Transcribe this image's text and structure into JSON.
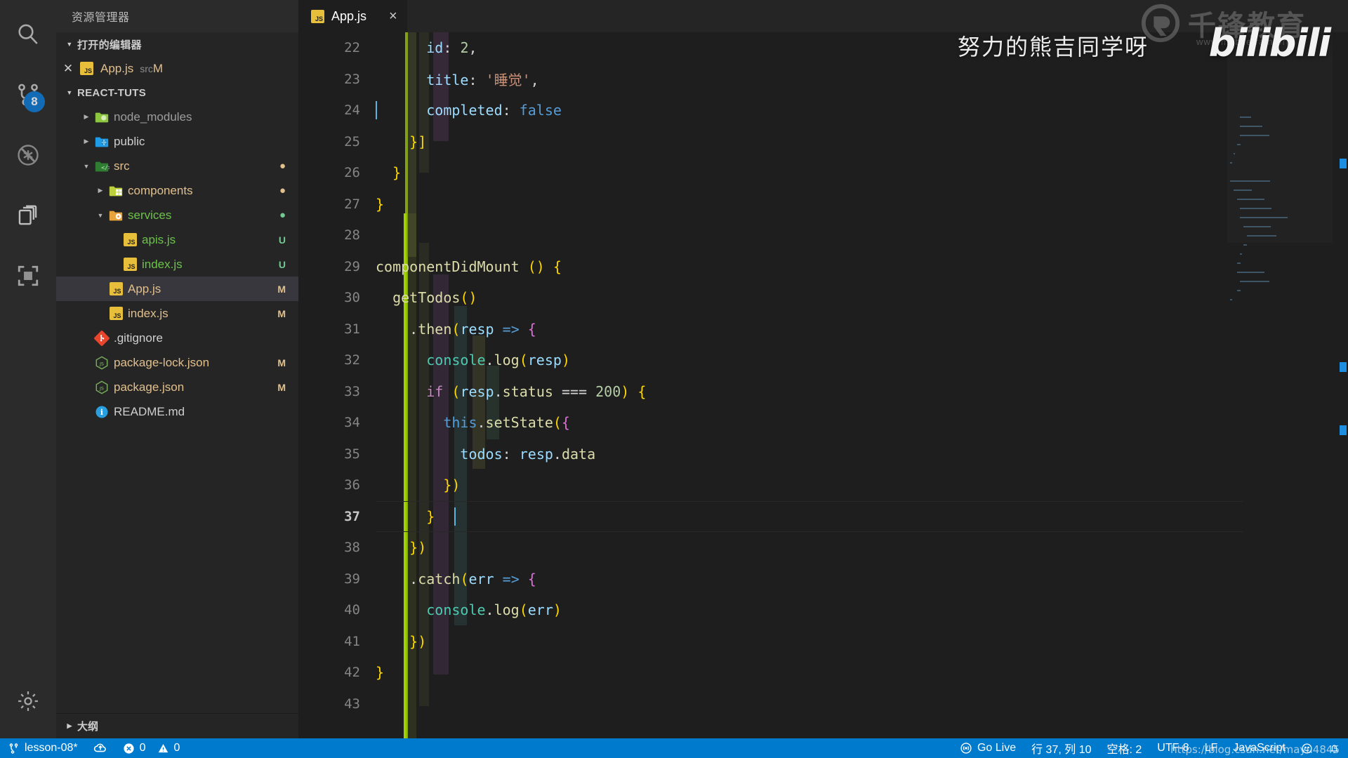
{
  "activity_bar": {
    "items": [
      {
        "name": "search-icon",
        "label": "搜索"
      },
      {
        "name": "source-control-icon",
        "label": "源代码管理",
        "badge": "8"
      },
      {
        "name": "run-debug-disabled-icon",
        "label": "运行和调试"
      },
      {
        "name": "extensions-copy-icon",
        "label": "扩展"
      },
      {
        "name": "remote-explorer-icon",
        "label": "远程资源管理器"
      },
      {
        "name": "settings-gear-icon",
        "label": "管理"
      }
    ]
  },
  "sidebar": {
    "title": "资源管理器",
    "open_editors": {
      "header": "打开的编辑器",
      "items": [
        {
          "name": "App.js",
          "folder": "src",
          "marker": "M",
          "icon": "js-icon"
        }
      ]
    },
    "project": {
      "header": "REACT-TUTS",
      "tree": [
        {
          "label": "node_modules",
          "type": "folder",
          "depth": 1,
          "expanded": false,
          "icon": "folder-node-modules",
          "color": "#9d9d9d",
          "marker": "",
          "dot": ""
        },
        {
          "label": "public",
          "type": "folder",
          "depth": 1,
          "expanded": false,
          "icon": "folder-public",
          "color": "#cfcfcf",
          "marker": "",
          "dot": ""
        },
        {
          "label": "src",
          "type": "folder",
          "depth": 1,
          "expanded": true,
          "icon": "folder-src",
          "color": "#e2c08d",
          "marker": "",
          "dot": "M"
        },
        {
          "label": "components",
          "type": "folder",
          "depth": 2,
          "expanded": false,
          "icon": "folder-components",
          "color": "#e2c08d",
          "marker": "",
          "dot": "M"
        },
        {
          "label": "services",
          "type": "folder",
          "depth": 2,
          "expanded": true,
          "icon": "folder-services",
          "color": "#6cc24a",
          "marker": "",
          "dot": "U"
        },
        {
          "label": "apis.js",
          "type": "file",
          "depth": 3,
          "expanded": null,
          "icon": "js-icon",
          "color": "#6cc24a",
          "marker": "U",
          "dot": ""
        },
        {
          "label": "index.js",
          "type": "file",
          "depth": 3,
          "expanded": null,
          "icon": "js-icon",
          "color": "#6cc24a",
          "marker": "U",
          "dot": ""
        },
        {
          "label": "App.js",
          "type": "file",
          "depth": 2,
          "expanded": null,
          "icon": "js-icon",
          "color": "#e2c08d",
          "marker": "M",
          "dot": "",
          "selected": true
        },
        {
          "label": "index.js",
          "type": "file",
          "depth": 2,
          "expanded": null,
          "icon": "js-icon",
          "color": "#e2c08d",
          "marker": "M",
          "dot": ""
        },
        {
          "label": ".gitignore",
          "type": "file",
          "depth": 1,
          "expanded": null,
          "icon": "git-icon",
          "color": "#cfcfcf",
          "marker": "",
          "dot": ""
        },
        {
          "label": "package-lock.json",
          "type": "file",
          "depth": 1,
          "expanded": null,
          "icon": "json-icon",
          "color": "#e2c08d",
          "marker": "M",
          "dot": ""
        },
        {
          "label": "package.json",
          "type": "file",
          "depth": 1,
          "expanded": null,
          "icon": "json-icon",
          "color": "#e2c08d",
          "marker": "M",
          "dot": ""
        },
        {
          "label": "README.md",
          "type": "file",
          "depth": 1,
          "expanded": null,
          "icon": "info-icon",
          "color": "#cfcfcf",
          "marker": "",
          "dot": ""
        }
      ]
    },
    "outline_header": "大纲"
  },
  "editor": {
    "tabs": [
      {
        "label": "App.js",
        "icon": "js-icon",
        "active": true,
        "close": "×"
      }
    ],
    "first_line_number": 22,
    "current_line": 37,
    "lines": [
      {
        "n": 22,
        "text": "      id: 2,"
      },
      {
        "n": 23,
        "text": "      title: '睡觉',"
      },
      {
        "n": 24,
        "text": "      completed: false"
      },
      {
        "n": 25,
        "text": "    }]"
      },
      {
        "n": 26,
        "text": "  }"
      },
      {
        "n": 27,
        "text": "}"
      },
      {
        "n": 28,
        "text": ""
      },
      {
        "n": 29,
        "text": "componentDidMount () {"
      },
      {
        "n": 30,
        "text": "  getTodos()"
      },
      {
        "n": 31,
        "text": "    .then(resp => {"
      },
      {
        "n": 32,
        "text": "      console.log(resp)"
      },
      {
        "n": 33,
        "text": "      if (resp.status === 200) {"
      },
      {
        "n": 34,
        "text": "        this.setState({"
      },
      {
        "n": 35,
        "text": "          todos: resp.data"
      },
      {
        "n": 36,
        "text": "        })"
      },
      {
        "n": 37,
        "text": "      }"
      },
      {
        "n": 38,
        "text": "    })"
      },
      {
        "n": 39,
        "text": "    .catch(err => {"
      },
      {
        "n": 40,
        "text": "      console.log(err)"
      },
      {
        "n": 41,
        "text": "    })"
      },
      {
        "n": 42,
        "text": "}"
      },
      {
        "n": 43,
        "text": ""
      }
    ]
  },
  "status_bar": {
    "left": [
      {
        "name": "branch-status",
        "icon": "source-control-icon",
        "label": "lesson-08*"
      },
      {
        "name": "sync-status",
        "icon": "cloud-sync-icon",
        "label": ""
      },
      {
        "name": "errors-status",
        "icon": "error-circle-icon",
        "label": "0"
      },
      {
        "name": "warnings-status",
        "icon": "warning-triangle-icon",
        "label": "0"
      }
    ],
    "right": [
      {
        "name": "go-live",
        "icon": "broadcast-icon",
        "label": "Go Live"
      },
      {
        "name": "cursor-position",
        "icon": "",
        "label": "行 37, 列 10"
      },
      {
        "name": "indentation",
        "icon": "",
        "label": "空格: 2"
      },
      {
        "name": "encoding",
        "icon": "",
        "label": "UTF-8"
      },
      {
        "name": "eol",
        "icon": "",
        "label": "LF"
      },
      {
        "name": "language-mode",
        "icon": "",
        "label": "JavaScript"
      },
      {
        "name": "feedback",
        "icon": "smiley-icon",
        "label": ""
      },
      {
        "name": "notifications",
        "icon": "bell-icon",
        "label": ""
      }
    ]
  },
  "watermarks": {
    "channel_name": "努力的熊吉同学呀",
    "platform": "bilibili",
    "education_brand": "千锋教育",
    "education_url": "www.mobiletrain.org",
    "bottom_url": "https://blog.csdn.net/mayu4845"
  },
  "colors": {
    "accent": "#007acc",
    "sidebar_bg": "#252526",
    "editor_bg": "#1e1e1e",
    "activity_bg": "#2b2b2b",
    "selected_row": "#37373d",
    "badge_blue": "#0e7ad4",
    "modified_marker": "#e2c08d",
    "untracked_marker": "#73c991"
  }
}
